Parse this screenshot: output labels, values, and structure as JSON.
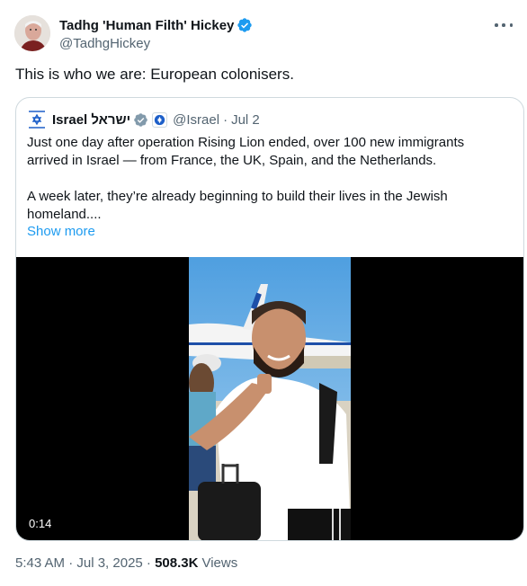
{
  "author": {
    "display_name": "Tadhg 'Human Filth' Hickey",
    "handle": "@TadhgHickey"
  },
  "post": {
    "text": "This is who we are: European colonisers."
  },
  "quoted_post": {
    "display_name": "Israel ישראל",
    "handle": "@Israel",
    "separator": "·",
    "date": "Jul 2",
    "paragraph_1": "Just one day after operation Rising Lion ended, over 100 new immigrants arrived in Israel — from France, the UK, Spain, and the Netherlands.",
    "paragraph_2": "A week later, they’re already beginning to build their lives in the Jewish homeland....",
    "show_more": "Show more",
    "video_duration": "0:14"
  },
  "meta": {
    "timestamp": "5:43 AM · Jul 3, 2025 · ",
    "views_count": "508.3K",
    "views_label": "Views"
  },
  "colors": {
    "accent": "#1d9bf0",
    "secondary_text": "#536471",
    "border": "#cfd9de"
  },
  "icons": [
    "verified-badge-icon",
    "more-icon",
    "israel-flag-icon",
    "government-badge-icon"
  ]
}
